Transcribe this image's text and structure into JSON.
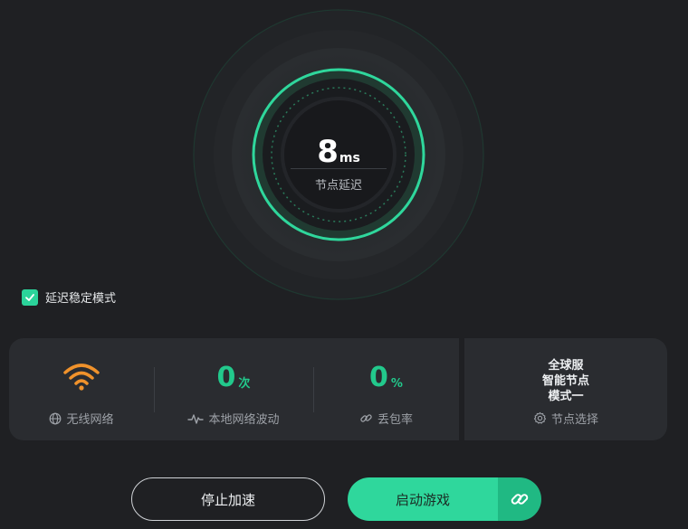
{
  "gauge": {
    "value": "8",
    "unit": "ms",
    "label": "节点延迟"
  },
  "mode": {
    "label": "延迟稳定模式",
    "checked": true
  },
  "stats": {
    "wifi": {
      "caption": "无线网络",
      "icon": "wifi-icon"
    },
    "jitter": {
      "value": "0",
      "unit": "次",
      "caption": "本地网络波动",
      "icon": "pulse-icon"
    },
    "loss": {
      "value": "0",
      "unit": "%",
      "caption": "丢包率",
      "icon": "link-icon"
    }
  },
  "node": {
    "line1": "全球服",
    "line2": "智能节点",
    "line3": "模式一",
    "caption": "节点选择",
    "icon": "gear-icon"
  },
  "buttons": {
    "stop": "停止加速",
    "start": "启动游戏",
    "link_icon": "chain-link-icon"
  },
  "colors": {
    "accent": "#2bd39a",
    "accent_dark": "#20b983",
    "wifi": "#f0922b",
    "background": "#1f2023",
    "panel": "#2a2c30"
  }
}
